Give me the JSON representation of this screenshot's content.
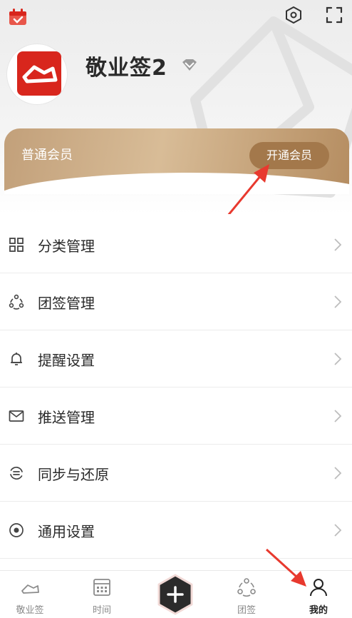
{
  "header": {
    "app_name": "敬业签2"
  },
  "membership": {
    "level": "普通会员",
    "open_label": "开通会员"
  },
  "menu": [
    {
      "label": "分类管理",
      "icon": "grid-icon"
    },
    {
      "label": "团签管理",
      "icon": "team-circle-icon"
    },
    {
      "label": "提醒设置",
      "icon": "bell-icon"
    },
    {
      "label": "推送管理",
      "icon": "mail-icon"
    },
    {
      "label": "同步与还原",
      "icon": "sync-icon"
    },
    {
      "label": "通用设置",
      "icon": "settings-dot-icon"
    }
  ],
  "tabs": [
    {
      "label": "敬业签",
      "icon": "note-icon"
    },
    {
      "label": "时间",
      "icon": "calendar-icon"
    },
    {
      "label": "团签",
      "icon": "team-circle-icon"
    },
    {
      "label": "我的",
      "icon": "person-icon",
      "active": true
    }
  ],
  "colors": {
    "brand_red": "#d8261d",
    "gold": "#c2a07a",
    "gold_button": "#a3784b",
    "arrow_red": "#e8392e"
  }
}
